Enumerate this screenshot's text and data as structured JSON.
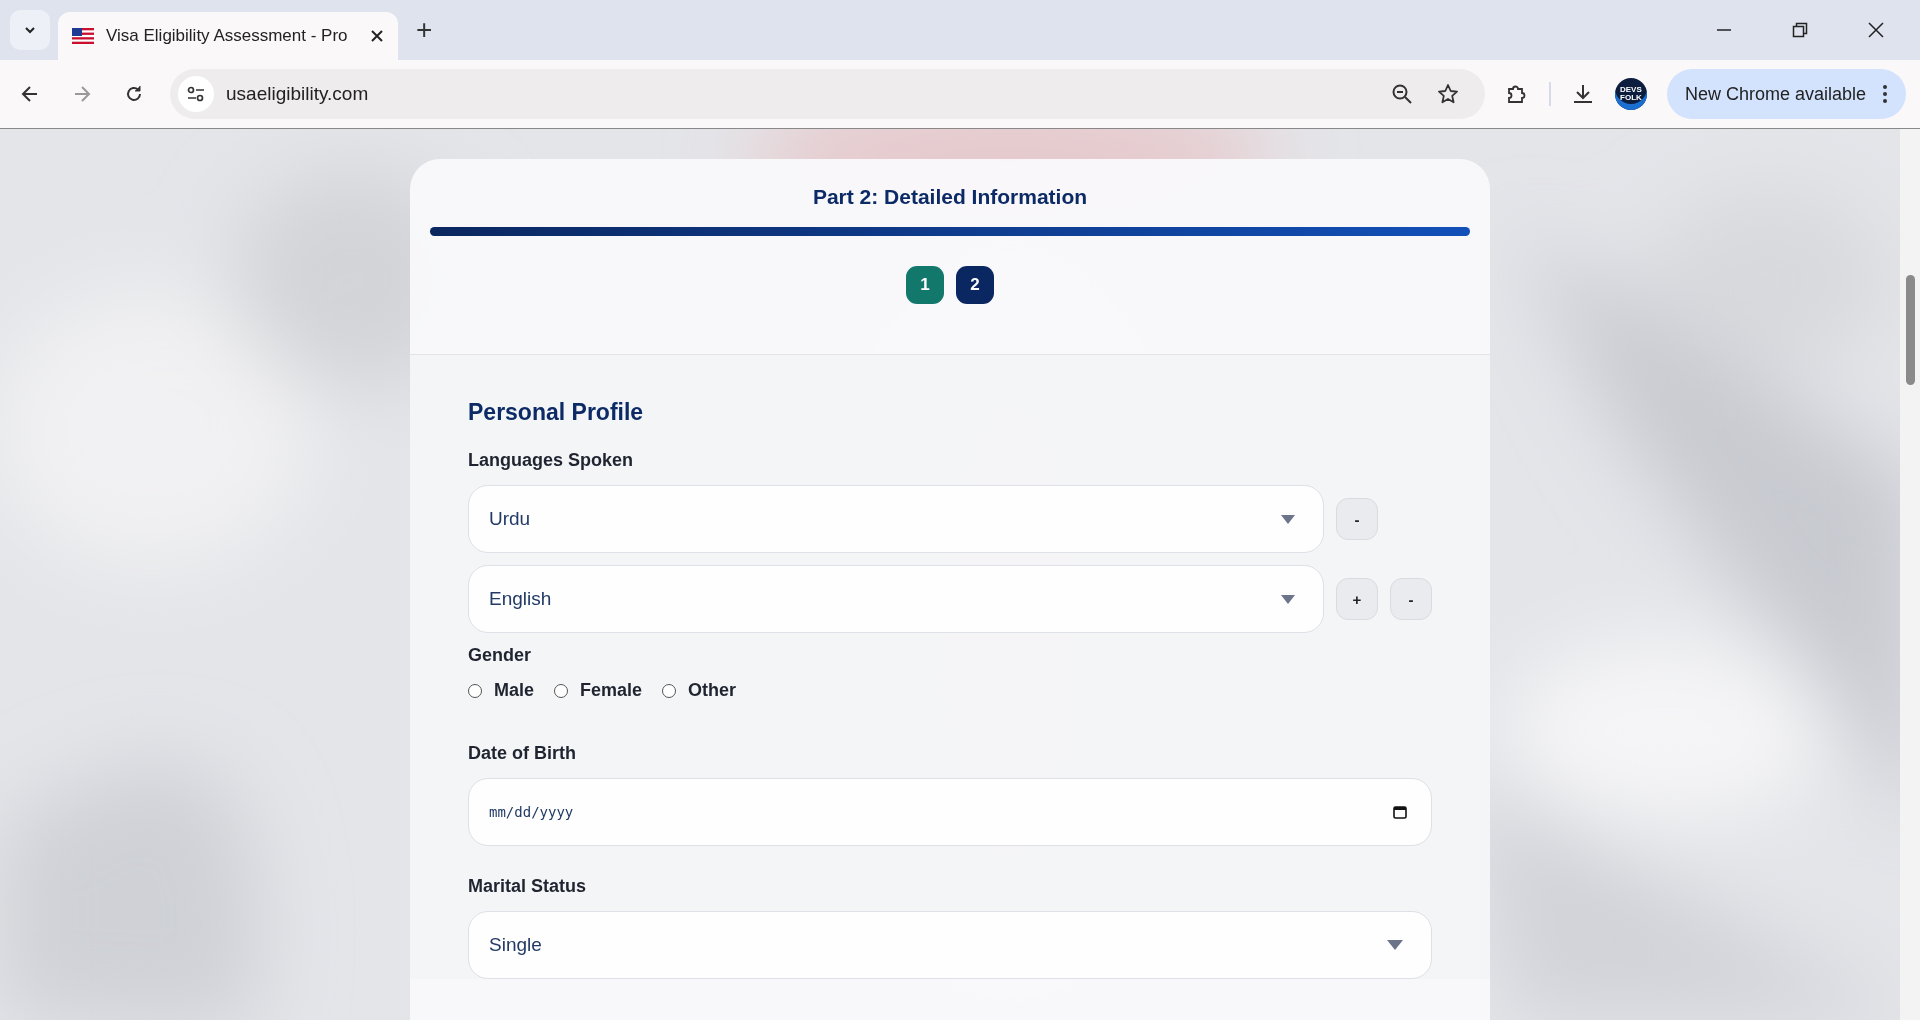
{
  "browser": {
    "tabs": [
      {
        "title": "Visa Eligibility Assessment - Pro",
        "selected": true
      }
    ],
    "new_tab": "+",
    "address": "usaeligibility.com",
    "profile_label": "DEVS FOLK",
    "update_button": "New Chrome available"
  },
  "form": {
    "title": "Part 2: Detailed Information",
    "progress": {
      "level": 1
    },
    "steps": [
      {
        "label": "1",
        "selected": false
      },
      {
        "label": "2",
        "selected": true
      }
    ],
    "section_title": "Personal Profile",
    "languages": {
      "label": "Languages Spoken",
      "rows": [
        {
          "value": "Urdu",
          "buttons": [
            "-"
          ]
        },
        {
          "value": "English",
          "buttons": [
            "+",
            "-"
          ]
        }
      ]
    },
    "gender": {
      "label": "Gender",
      "options": [
        {
          "label": "Male",
          "selected": false
        },
        {
          "label": "Female",
          "selected": false
        },
        {
          "label": "Other",
          "selected": false
        }
      ]
    },
    "date_of_birth": {
      "label": "Date of Birth",
      "placeholder": "mm/dd/yyyy"
    },
    "marital_status": {
      "label": "Marital Status",
      "value": "Single"
    }
  }
}
